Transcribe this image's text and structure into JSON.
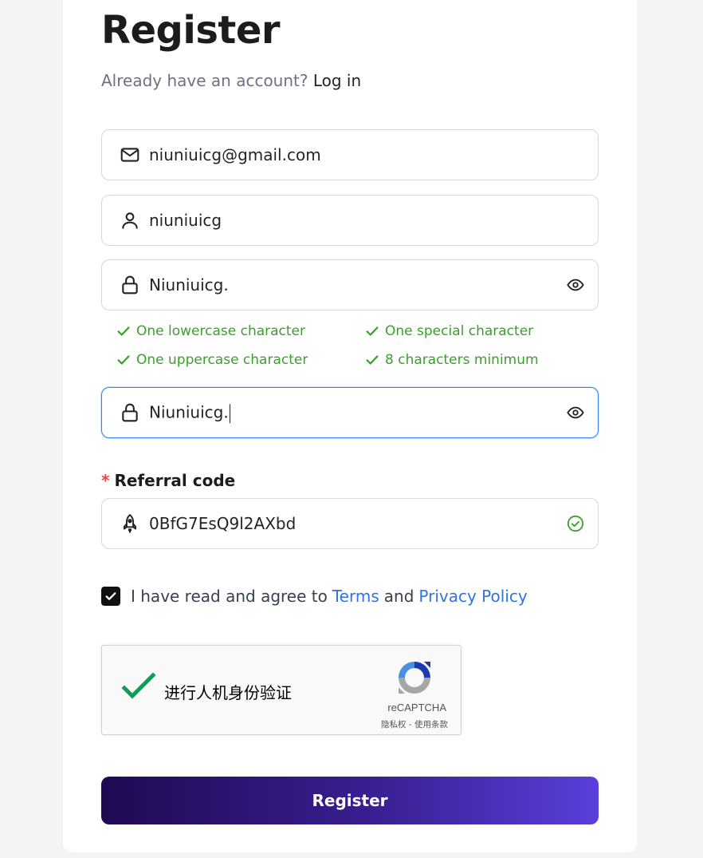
{
  "header": {
    "title": "Register",
    "have_account_text": "Already have an account?",
    "login_link": "Log in"
  },
  "form": {
    "email": {
      "value": "niuniuicg@gmail.com",
      "icon": "mail-icon"
    },
    "username": {
      "value": "niuniuicg",
      "icon": "user-icon"
    },
    "password": {
      "value": "Niuniuicg.",
      "icon": "lock-icon",
      "toggle_icon": "eye-icon"
    },
    "password_rules": [
      {
        "text": "One lowercase character",
        "met": true
      },
      {
        "text": "One special character",
        "met": true
      },
      {
        "text": "One uppercase character",
        "met": true
      },
      {
        "text": "8 characters minimum",
        "met": true
      }
    ],
    "confirm_password": {
      "value": "Niuniuicg.",
      "icon": "lock-icon",
      "toggle_icon": "eye-icon"
    },
    "referral": {
      "required_mark": "*",
      "label": "Referral code",
      "value": "0BfG7EsQ9l2AXbd",
      "icon": "rocket-icon",
      "status_icon": "check-circle-icon"
    },
    "agree": {
      "checked": true,
      "text": "I have read and agree to",
      "terms": "Terms",
      "and": "and",
      "privacy": "Privacy Policy"
    },
    "recaptcha": {
      "label": "进行人机身份验证",
      "brand": "reCAPTCHA",
      "links": "隐私权 - 使用条款",
      "verified": true
    },
    "submit_label": "Register"
  },
  "colors": {
    "success": "#3aa02b",
    "link": "#2f74e6",
    "required": "#e5484d",
    "button_gradient_start": "#1f0a53",
    "button_gradient_end": "#5a3fdb",
    "focus_border": "#3b82f6"
  }
}
